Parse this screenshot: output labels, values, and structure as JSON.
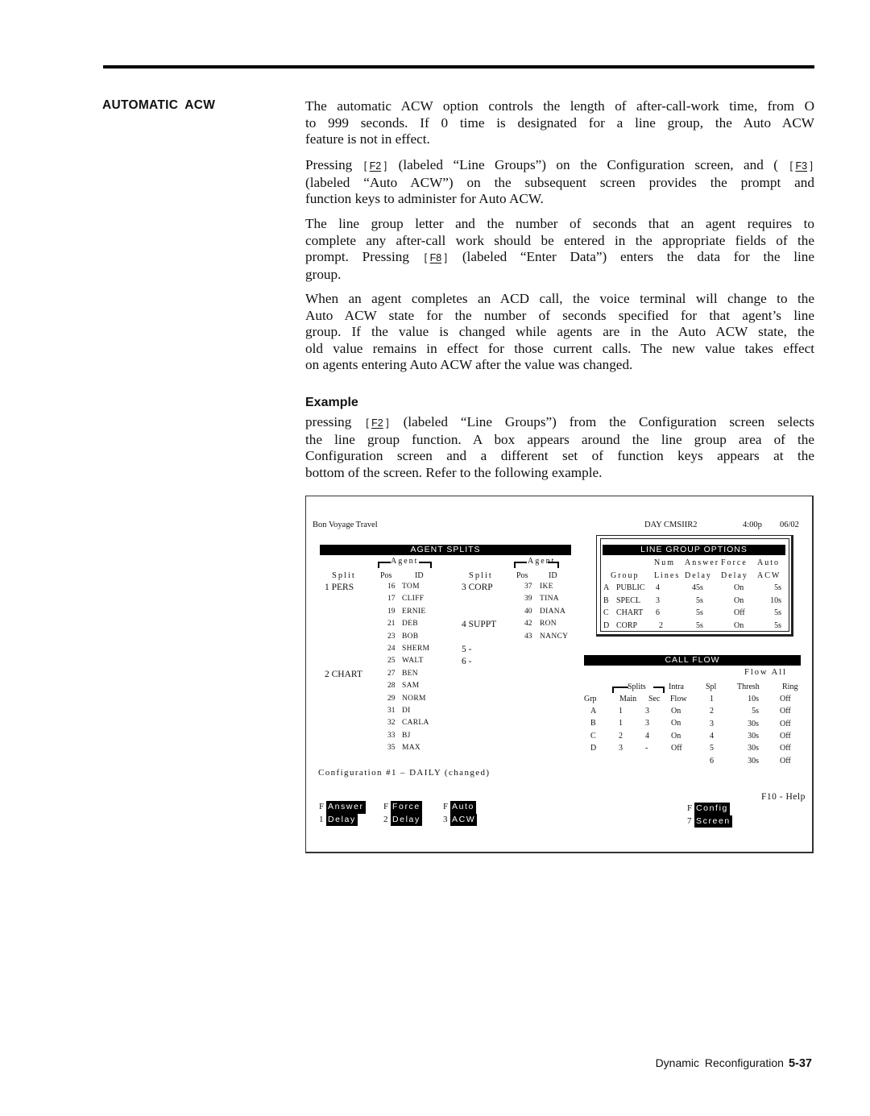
{
  "section": {
    "heading": "AUTOMATIC  ACW"
  },
  "paragraphs": [
    {
      "lines": [
        [
          "The automatic ACW option controls the length of after-call-work time, from O"
        ],
        [
          "to 999 seconds. If 0 time is designated for a line group, the Auto ACW"
        ],
        [
          "feature is not in effect."
        ]
      ]
    },
    {
      "lines": [
        [
          "Pressing ",
          {
            "key": "F2"
          },
          " (labeled “Line Groups”) on the Configuration screen, and ( ",
          {
            "key": "F3"
          }
        ],
        [
          "(labeled “Auto ACW”) on the subsequent screen provides the prompt and"
        ],
        [
          "function keys to administer for Auto ACW."
        ]
      ]
    },
    {
      "lines": [
        [
          "The line group letter and the number of seconds that an agent requires to"
        ],
        [
          "complete any after-call work should be entered in the appropriate fields of the"
        ],
        [
          "prompt. Pressing ",
          {
            "key": "F8"
          },
          " (labeled “Enter Data”) enters the data for the line"
        ],
        [
          "group."
        ]
      ]
    },
    {
      "lines": [
        [
          "When an agent completes an ACD call, the voice terminal will change to the"
        ],
        [
          "Auto ACW state for the number of seconds specified for that agent’s line"
        ],
        [
          "group. If the value is changed while agents are in the Auto ACW state, the"
        ],
        [
          "old value remains in effect for those current calls. The new value takes effect"
        ],
        [
          "on agents entering Auto ACW after the value was changed."
        ]
      ]
    }
  ],
  "example": {
    "heading": "Example",
    "lines": [
      [
        "pressing ",
        {
          "key": "F2"
        },
        " (labeled “Line Groups”) from the Configuration screen selects"
      ],
      [
        "the line group function.  A box appears around the line group area of the"
      ],
      [
        "Configuration screen and a different set of function keys appears at the"
      ],
      [
        "bottom of the screen. Refer to the following example."
      ]
    ]
  },
  "screen": {
    "company": "Bon  Voyage  Travel",
    "status": {
      "mode": "DAY  CMSIIR2",
      "time": "4:00p",
      "date": "06/02"
    },
    "agent_splits": {
      "title": "AGENT  SPLITS",
      "agent_group_label": "Agent",
      "col_split": "Split",
      "col_pos": "Pos",
      "col_id": "ID",
      "left_splits": [
        {
          "split": "1  PERS",
          "agents": [
            {
              "pos": "16",
              "id": "TOM"
            },
            {
              "pos": "17",
              "id": "CLIFF"
            },
            {
              "pos": "19",
              "id": "ERNIE"
            },
            {
              "pos": "21",
              "id": "DEB"
            },
            {
              "pos": "23",
              "id": "BOB"
            },
            {
              "pos": "24",
              "id": "SHERM"
            },
            {
              "pos": "25",
              "id": "WALT"
            }
          ]
        },
        {
          "split": "2  CHART",
          "agents": [
            {
              "pos": "27",
              "id": "BEN"
            },
            {
              "pos": "28",
              "id": "SAM"
            },
            {
              "pos": "29",
              "id": "NORM"
            },
            {
              "pos": "31",
              "id": "DI"
            },
            {
              "pos": "32",
              "id": "CARLA"
            },
            {
              "pos": "33",
              "id": "BJ"
            },
            {
              "pos": "35",
              "id": "MAX"
            }
          ]
        }
      ],
      "right_splits": [
        {
          "split": "3  CORP",
          "agents": [
            {
              "pos": "37",
              "id": "IKE"
            },
            {
              "pos": "39",
              "id": "TINA"
            },
            {
              "pos": "40",
              "id": "DIANA"
            }
          ]
        },
        {
          "split": "4  SUPPT",
          "agents": [
            {
              "pos": "42",
              "id": "RON"
            },
            {
              "pos": "43",
              "id": "NANCY"
            }
          ]
        },
        {
          "split": "5  -",
          "agents": []
        },
        {
          "split": "6  -",
          "agents": []
        }
      ]
    },
    "line_group_options": {
      "title": "LINE  GROUP  OPTIONS",
      "header_row1": [
        "",
        "Num",
        "Answer",
        "Force",
        "Auto"
      ],
      "header_row2": [
        "Group",
        "Lines",
        "Delay",
        "Delay",
        "ACW"
      ],
      "rows": [
        {
          "letter": "A",
          "group": "PUBLIC",
          "lines": "4",
          "answer_delay": "45s",
          "force_delay": "On",
          "auto_acw": "5s"
        },
        {
          "letter": "B",
          "group": "SPECL",
          "lines": "3",
          "answer_delay": "5s",
          "force_delay": "On",
          "auto_acw": "10s"
        },
        {
          "letter": "C",
          "group": "CHART",
          "lines": "6",
          "answer_delay": "5s",
          "force_delay": "Off",
          "auto_acw": "5s"
        },
        {
          "letter": "D",
          "group": "CORP",
          "lines": "2",
          "answer_delay": "5s",
          "force_delay": "On",
          "auto_acw": "5s"
        }
      ]
    },
    "call_flow": {
      "title": "CALL  FLOW",
      "flow_all_label": "Flow   All",
      "splits_label": "Splits",
      "col_intra": "Intra",
      "col_spl": "Spl",
      "col_thresh": "Thresh",
      "col_ring": "Ring",
      "col_grp": "Grp",
      "col_main": "Main",
      "col_sec": "Sec",
      "col_flow": "Flow",
      "group_rows": [
        {
          "grp": "A",
          "main": "1",
          "sec": "3",
          "flow": "On"
        },
        {
          "grp": "B",
          "main": "1",
          "sec": "3",
          "flow": "On"
        },
        {
          "grp": "C",
          "main": "2",
          "sec": "4",
          "flow": "On"
        },
        {
          "grp": "D",
          "main": "3",
          "sec": "-",
          "flow": "Off"
        }
      ],
      "split_rows": [
        {
          "spl": "1",
          "thresh": "10s",
          "ring": "Off"
        },
        {
          "spl": "2",
          "thresh": "5s",
          "ring": "Off"
        },
        {
          "spl": "3",
          "thresh": "30s",
          "ring": "Off"
        },
        {
          "spl": "4",
          "thresh": "30s",
          "ring": "Off"
        },
        {
          "spl": "5",
          "thresh": "30s",
          "ring": "Off"
        },
        {
          "spl": "6",
          "thresh": "30s",
          "ring": "Off"
        }
      ]
    },
    "configuration_line": "Configuration  #1  –  DAILY  (changed)",
    "help": "F10  -  Help",
    "function_keys": [
      {
        "f": "F",
        "n": "1",
        "line1": "Answer",
        "line2": "Delay"
      },
      {
        "f": "F",
        "n": "2",
        "line1": "Force",
        "line2": "Delay"
      },
      {
        "f": "F",
        "n": "3",
        "line1": "Auto",
        "line2": "ACW"
      },
      {
        "f": "F",
        "n": "7",
        "line1": "Config",
        "line2": "Screen"
      }
    ]
  },
  "footer": {
    "section_name": "Dynamic  Reconfiguration",
    "page_number": "5-37"
  }
}
